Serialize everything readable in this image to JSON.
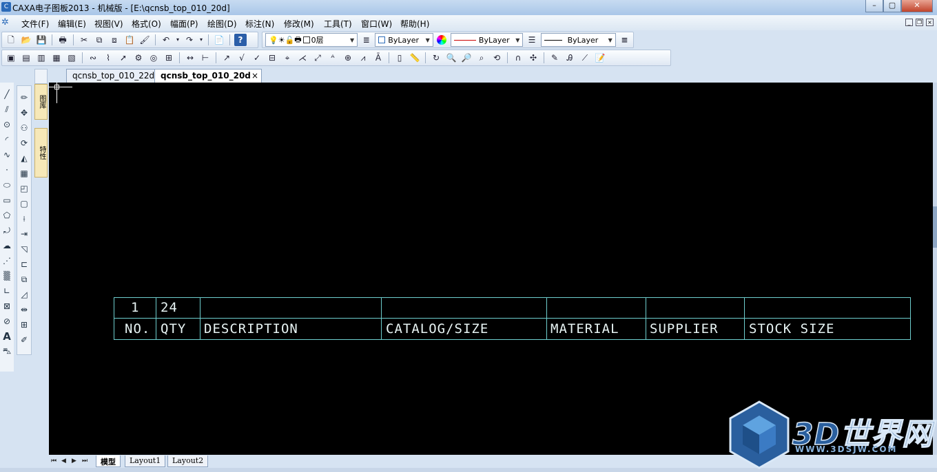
{
  "window": {
    "title": "CAXA电子图板2013 - 机械版 - [E:\\qcnsb_top_010_20d]",
    "controls": [
      "–",
      "▢",
      "✕"
    ]
  },
  "menu": {
    "items": [
      "文件(F)",
      "编辑(E)",
      "视图(V)",
      "格式(O)",
      "幅面(P)",
      "绘图(D)",
      "标注(N)",
      "修改(M)",
      "工具(T)",
      "窗口(W)",
      "帮助(H)"
    ]
  },
  "toolbar": {
    "layer_value": "0层",
    "color_value": "ByLayer",
    "linetype_value": "ByLayer",
    "lineweight_value": "ByLayer"
  },
  "side_tabs": {
    "library": "图库",
    "properties": "特性"
  },
  "tabs": [
    {
      "label": "qcnsb_top_010_22d",
      "active": false
    },
    {
      "label": "qcnsb_top_010_20d",
      "active": true
    }
  ],
  "bom_table": {
    "row1": [
      "1",
      "24",
      "",
      "",
      "",
      "",
      ""
    ],
    "header": [
      "NO.",
      "QTY",
      "DESCRIPTION",
      "CATALOG/SIZE",
      "MATERIAL",
      "SUPPLIER",
      "STOCK SIZE"
    ],
    "line_color": "#6fd0d0"
  },
  "layout_tabs": [
    "模型",
    "Layout1",
    "Layout2"
  ],
  "watermark": {
    "text": "3D世界网",
    "url": "WWW.3DSJW.COM"
  }
}
